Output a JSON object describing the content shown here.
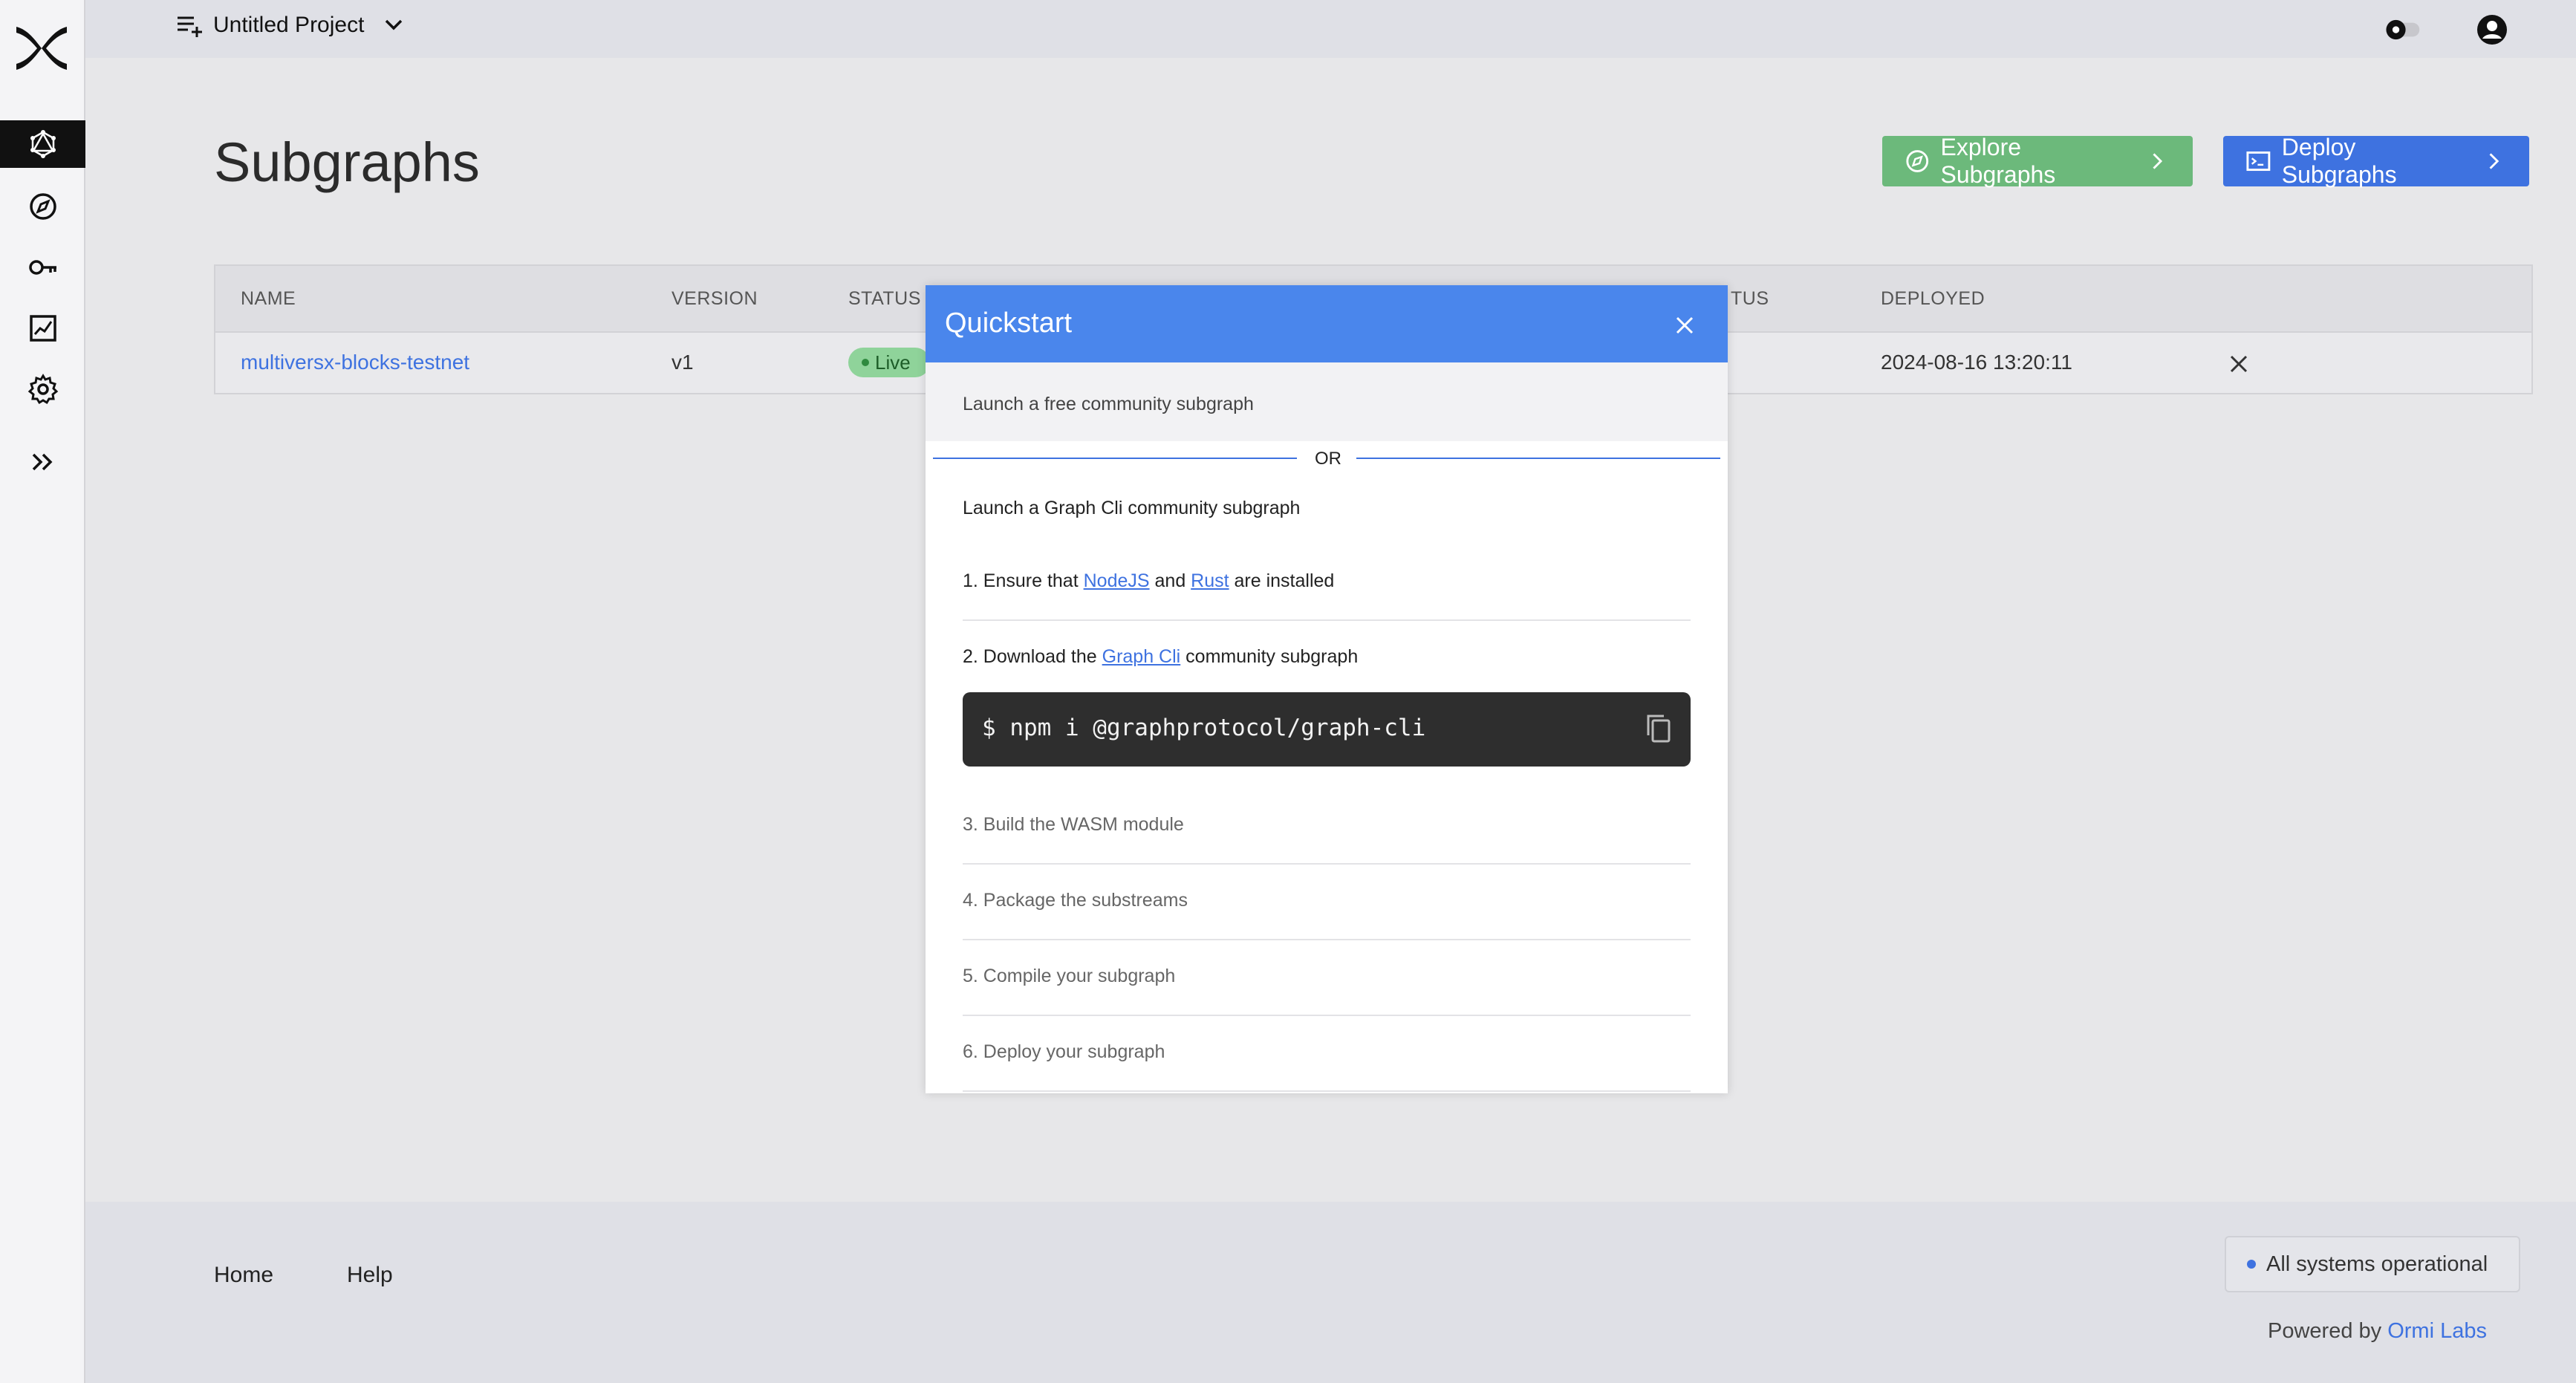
{
  "header": {
    "project_name": "Untitled Project"
  },
  "sidebar": {
    "items": [
      {
        "icon": "graph-icon",
        "active": true
      },
      {
        "icon": "compass-icon",
        "active": false
      },
      {
        "icon": "key-icon",
        "active": false
      },
      {
        "icon": "chart-icon",
        "active": false
      },
      {
        "icon": "gear-icon",
        "active": false
      },
      {
        "icon": "double-chevron-right-icon",
        "active": false
      }
    ]
  },
  "main": {
    "title": "Subgraphs",
    "explore_label": "Explore Subgraphs",
    "deploy_label": "Deploy Subgraphs",
    "table": {
      "columns": [
        "NAME",
        "VERSION",
        "STATUS",
        "TUS",
        "DEPLOYED"
      ],
      "rows": [
        {
          "name": "multiversx-blocks-testnet",
          "version": "v1",
          "status": "Live",
          "deployed": "2024-08-16 13:20:11"
        }
      ]
    }
  },
  "modal": {
    "title": "Quickstart",
    "free_text": "Launch a free community subgraph",
    "or_text": "OR",
    "cli_title": "Launch a Graph Cli community subgraph",
    "step1": {
      "prefix": "1. Ensure that ",
      "link1": "NodeJS",
      "mid": " and ",
      "link2": "Rust",
      "suffix": " are installed"
    },
    "step2": {
      "prefix": "2. Download the ",
      "link": "Graph Cli",
      "suffix": " community subgraph"
    },
    "command": "$ npm i @graphprotocol/graph-cli",
    "step3": "3. Build the WASM module",
    "step4": "4. Package the substreams",
    "step5": "5. Compile your subgraph",
    "step6": "6. Deploy your subgraph"
  },
  "footer": {
    "home": "Home",
    "help": "Help",
    "status": "All systems operational",
    "powered_prefix": "Powered by ",
    "powered_link": "Ormi Labs"
  },
  "colors": {
    "accent": "#3e72e0",
    "explore": "#6cb97b",
    "modal_header": "#4a86ec",
    "live_badge": "#8fd39a"
  }
}
